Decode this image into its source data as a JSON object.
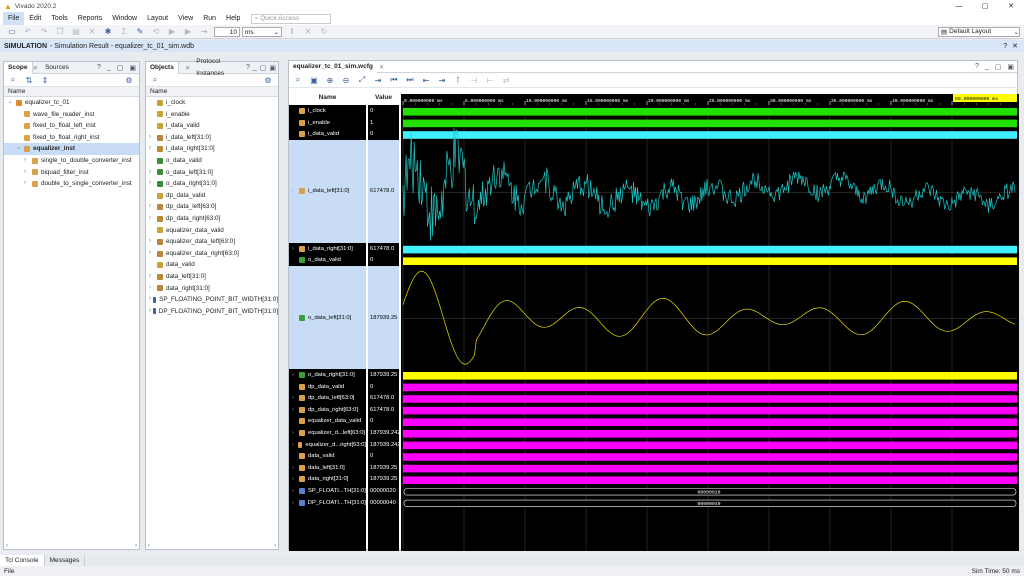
{
  "app": {
    "title": "Vivado 2020.2",
    "min": "—",
    "max": "▢",
    "close": "✕"
  },
  "menu": [
    "File",
    "Edit",
    "Tools",
    "Reports",
    "Window",
    "Layout",
    "View",
    "Run",
    "Help"
  ],
  "quick_access": {
    "placeholder": "Quick Access"
  },
  "toolbar": {
    "run_value": "10",
    "run_unit": "ms",
    "layout": "Default Layout"
  },
  "sim_bar": {
    "label": "SIMULATION",
    "text": "- Simulation Result - equalizer_tc_01_sim.wdb"
  },
  "scope_panel": {
    "tabs": [
      "Scope",
      "Sources"
    ],
    "col": "Name",
    "items": [
      {
        "label": "equalizer_tc_01",
        "depth": 0,
        "exp": "v"
      },
      {
        "label": "wave_file_reader_inst",
        "depth": 1,
        "exp": ""
      },
      {
        "label": "fixed_to_float_left_inst",
        "depth": 1,
        "exp": ""
      },
      {
        "label": "fixed_to_float_right_inst",
        "depth": 1,
        "exp": ""
      },
      {
        "label": "equalizer_inst",
        "depth": 1,
        "exp": "v",
        "sel": true
      },
      {
        "label": "single_to_double_converter_inst",
        "depth": 2,
        "exp": ">"
      },
      {
        "label": "biquad_filter_inst",
        "depth": 2,
        "exp": ">"
      },
      {
        "label": "double_to_single_converter_inst",
        "depth": 2,
        "exp": ">"
      }
    ]
  },
  "objects_panel": {
    "tabs": [
      "Objects",
      "Protocol Instances"
    ],
    "col": "Name",
    "items": [
      "i_clock",
      "i_enable",
      "i_data_valid",
      "i_data_left[31:0]",
      "i_data_right[31:0]",
      "o_data_valid",
      "o_data_left[31:0]",
      "o_data_right[31:0]",
      "dp_data_valid",
      "dp_data_left[63:0]",
      "dp_data_right[63:0]",
      "equalizer_data_valid",
      "equalizer_data_left[63:0]",
      "equalizer_data_right[63:0]",
      "data_valid",
      "data_left[31:0]",
      "data_right[31:0]",
      "SP_FLOATING_POINT_BIT_WIDTH[31:0]",
      "DP_FLOATING_POINT_BIT_WIDTH[31:0]"
    ]
  },
  "wave": {
    "tab": "equalizer_tc_01_sim.wcfg",
    "col_name": "Name",
    "col_value": "Value",
    "cursor": "50.000000000 ms",
    "ticks": [
      "0.000000000 ms",
      "5.000000000 ms",
      "10.000000000 ms",
      "15.000000000 ms",
      "20.000000000 ms",
      "25.000000000 ms",
      "30.000000000 ms",
      "35.000000000 ms",
      "40.000000000 ms",
      "45.000000000 ms"
    ],
    "signals": [
      {
        "name": "i_clock",
        "value": "0",
        "kind": "bar",
        "color": "#22e000",
        "h": 11
      },
      {
        "name": "i_enable",
        "value": "1",
        "kind": "bar",
        "color": "#22e000",
        "h": 11
      },
      {
        "name": "i_data_valid",
        "value": "0",
        "kind": "bar",
        "color": "#40f0ff",
        "h": 11
      },
      {
        "name": "i_data_left[31:0]",
        "value": "617478.0",
        "kind": "analog",
        "color": "#1fc8c8",
        "h": 103,
        "hl": true
      },
      {
        "name": "i_data_right[31:0]",
        "value": "617478.0",
        "kind": "bar",
        "color": "#40f0ff",
        "h": 11
      },
      {
        "name": "o_data_valid",
        "value": "0",
        "kind": "bar",
        "color": "#ffff00",
        "h": 11
      },
      {
        "name": "o_data_left[31:0]",
        "value": "187939.25",
        "kind": "analog",
        "color": "#e8e000",
        "h": 103,
        "hl": true
      },
      {
        "name": "o_data_right[31:0]",
        "value": "187939.25",
        "kind": "bar",
        "color": "#ffff00",
        "h": 11
      },
      {
        "name": "dp_data_valid",
        "value": "0",
        "kind": "bar",
        "color": "#ff00ff",
        "h": 11
      },
      {
        "name": "dp_data_left[63:0]",
        "value": "617478.0",
        "kind": "bar",
        "color": "#ff00ff",
        "h": 11
      },
      {
        "name": "dp_data_right[63:0]",
        "value": "617478.0",
        "kind": "bar",
        "color": "#ff00ff",
        "h": 11
      },
      {
        "name": "equalizer_data_valid",
        "value": "0",
        "kind": "bar",
        "color": "#ff00ff",
        "h": 11
      },
      {
        "name": "equalizer_d...left[63:0]",
        "value": "187939.242",
        "kind": "bar",
        "color": "#ff00ff",
        "h": 11
      },
      {
        "name": "equalizer_d...right[63:0]",
        "value": "187939.242",
        "kind": "bar",
        "color": "#ff00ff",
        "h": 11
      },
      {
        "name": "data_valid",
        "value": "0",
        "kind": "bar",
        "color": "#ff00ff",
        "h": 11
      },
      {
        "name": "data_left[31:0]",
        "value": "187939.25",
        "kind": "bar",
        "color": "#ff00ff",
        "h": 11
      },
      {
        "name": "data_right[31:0]",
        "value": "187939.25",
        "kind": "bar",
        "color": "#ff00ff",
        "h": 11
      },
      {
        "name": "SP_FLOATI...TH[31:0]",
        "value": "00000020",
        "kind": "bus",
        "label": "00000020",
        "h": 11
      },
      {
        "name": "DP_FLOATI...TH[31:0]",
        "value": "00000040",
        "kind": "bus",
        "label": "00000040",
        "h": 11
      }
    ]
  },
  "bottom_tabs": [
    "Tcl Console",
    "Messages"
  ],
  "status": {
    "left": "File",
    "right": "Sim Time: 50 ms"
  }
}
